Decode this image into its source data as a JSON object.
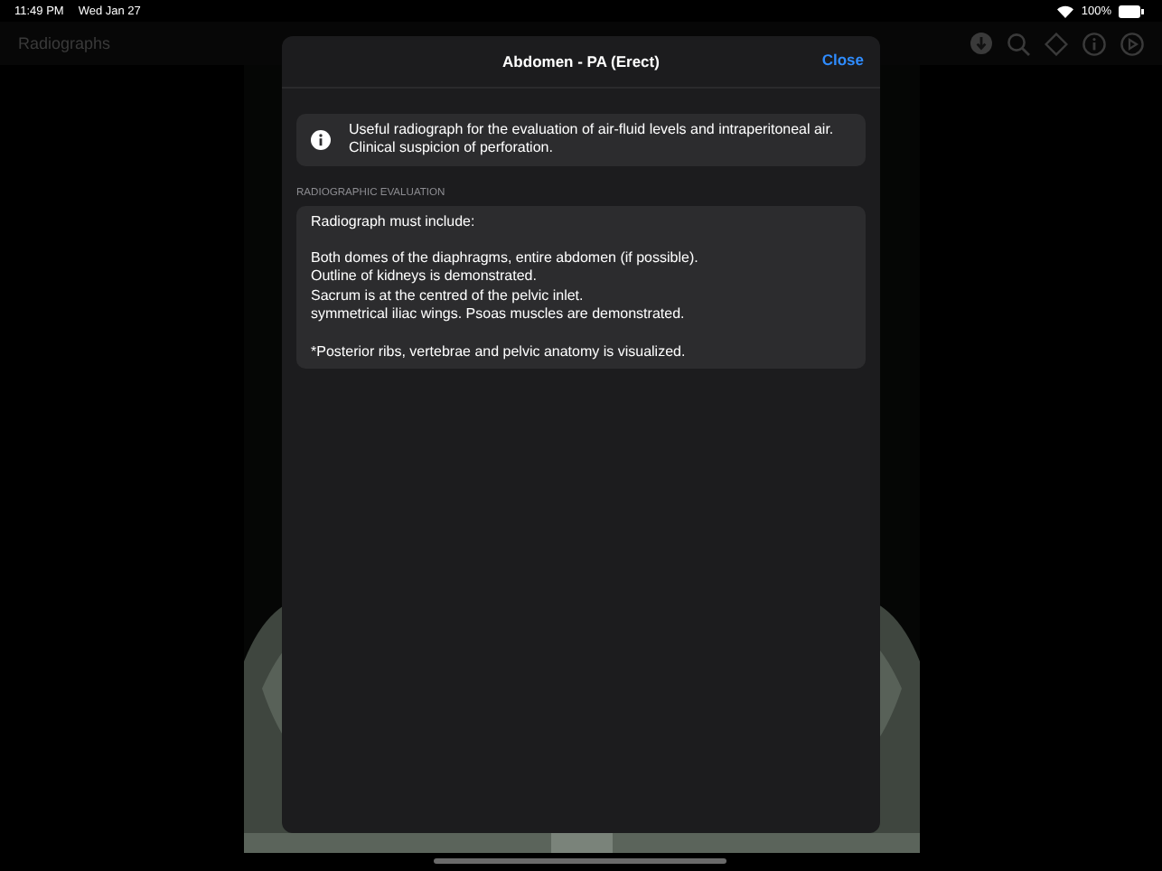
{
  "status_bar": {
    "time": "11:49 PM",
    "date": "Wed Jan 27",
    "battery": "100%"
  },
  "nav": {
    "title": "Radiographs"
  },
  "modal": {
    "title": "Abdomen - PA (Erect)",
    "close": "Close",
    "info_lines": [
      "Useful radiograph for the evaluation of air-fluid levels and intraperitoneal air.",
      "Clinical suspicion of perforation."
    ],
    "section_label": "RADIOGRAPHIC EVALUATION",
    "evaluation_paragraphs": [
      [
        "Radiograph must include:"
      ],
      [
        "Both domes of the diaphragms, entire abdomen (if possible).",
        "Outline of kidneys is demonstrated.",
        "Sacrum is at the centred of the pelvic inlet.",
        "symmetrical iliac wings. Psoas muscles are demonstrated."
      ],
      [
        "*Posterior ribs, vertebrae and pelvic anatomy is visualized."
      ]
    ]
  }
}
